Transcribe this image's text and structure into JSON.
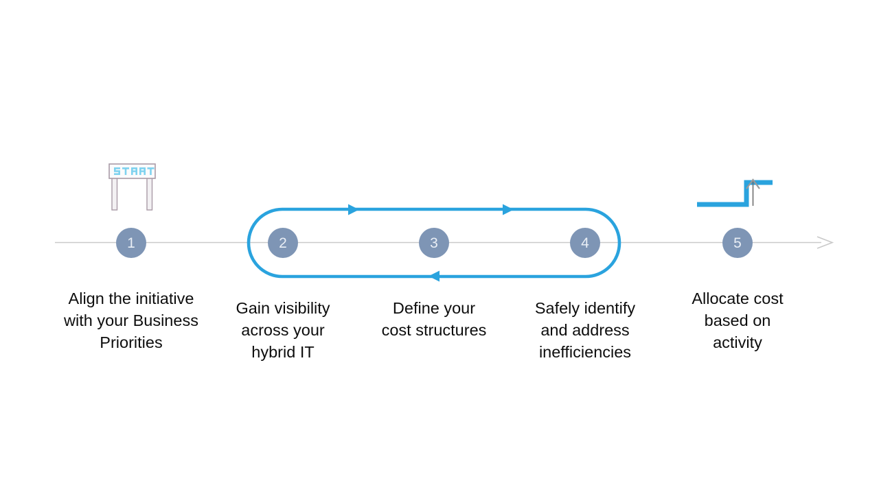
{
  "diagram": {
    "type": "timeline-process-flow",
    "title": "",
    "colors": {
      "accent_blue": "#2aa3de",
      "step_circle": "#7e95b5",
      "timeline_gray": "#c9c9c9",
      "text": "#0d0d0d",
      "start_gate_frame": "#a99aa6",
      "start_gate_text": "#7fd2ef"
    },
    "start_marker": {
      "icon": "start-gate-icon",
      "label": "START"
    },
    "end_marker": {
      "icon": "step-up-arrow-icon",
      "label": ""
    },
    "timeline_arrow": {
      "icon": "timeline-arrow-icon",
      "direction": "right"
    },
    "loop": {
      "icon": "iteration-loop-icon",
      "label": "",
      "covers_steps": [
        2,
        3,
        4
      ],
      "top_arrows": 2,
      "bottom_arrows": 1,
      "top_direction": "right",
      "bottom_direction": "left"
    },
    "steps": [
      {
        "number": "1",
        "caption": "Align the initiative\nwith your Business\nPriorities"
      },
      {
        "number": "2",
        "caption": "Gain visibility\nacross your\nhybrid IT"
      },
      {
        "number": "3",
        "caption": "Define your\ncost structures"
      },
      {
        "number": "4",
        "caption": "Safely identify\nand address\ninefficiencies"
      },
      {
        "number": "5",
        "caption": "Allocate cost\nbased on\nactivity"
      }
    ]
  }
}
